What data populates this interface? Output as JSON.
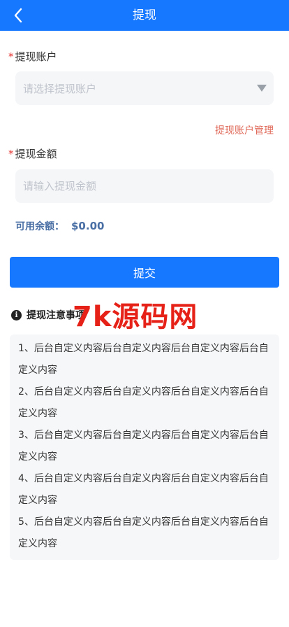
{
  "header": {
    "title": "提现",
    "back_icon": "chevron-left-icon"
  },
  "account": {
    "required_mark": "*",
    "label": "提现账户",
    "placeholder": "请选择提现账户",
    "dropdown_icon": "caret-down-icon",
    "manage_link": "提现账户管理"
  },
  "amount": {
    "required_mark": "*",
    "label": "提现金额",
    "placeholder": "请输入提现金额"
  },
  "balance": {
    "label": "可用余额：",
    "value": "$0.00"
  },
  "submit": {
    "label": "提交"
  },
  "notice": {
    "icon": "info-icon",
    "icon_glyph": "i",
    "title": "提现注意事项",
    "items": [
      "1、后台自定义内容后台自定义内容后台自定义内容后台自定义内容",
      "2、后台自定义内容后台自定义内容后台自定义内容后台自定义内容",
      "3、后台自定义内容后台自定义内容后台自定义内容后台自定义内容",
      "4、后台自定义内容后台自定义内容后台自定义内容后台自定义内容",
      "5、后台自定义内容后台自定义内容后台自定义内容后台自定义内容"
    ]
  },
  "watermark": {
    "text": "7k源码网"
  },
  "colors": {
    "primary": "#1677ff",
    "required": "#e53935",
    "link": "#e06a5a",
    "balance": "#4a6fa5",
    "watermark": "#e62117"
  }
}
